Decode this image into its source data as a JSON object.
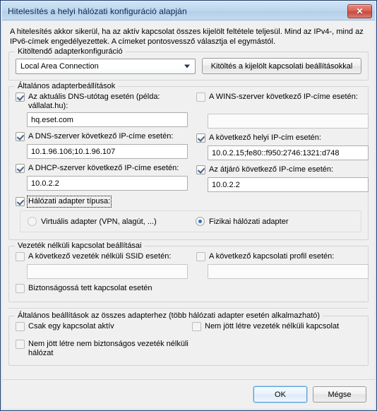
{
  "window": {
    "title": "Hitelesítés a helyi hálózati konfiguráció alapján",
    "close_label": "✕",
    "description": "A hitelesítés akkor sikerül, ha az aktív kapcsolat összes kijelölt feltétele teljesül. Mind az IPv4-, mind az IPv6-címek engedélyezettek. A címeket pontosvessző választja el egymástól."
  },
  "adapter_config": {
    "group_title": "Kitöltendő adapterkonfiguráció",
    "combo_value": "Local Area Connection",
    "fill_button_label": "Kitöltés a kijelölt kapcsolati beállításokkal"
  },
  "general_adapter": {
    "group_title": "Általános adapterbeállítások",
    "dns_suffix": {
      "label": "Az aktuális DNS-utótag esetén (példa: vállalat.hu):",
      "checked": true,
      "value": "hq.eset.com"
    },
    "wins_server": {
      "label": "A WINS-szerver következő IP-címe esetén:",
      "checked": false,
      "value": ""
    },
    "dns_server": {
      "label": "A DNS-szerver következő IP-címe esetén:",
      "checked": true,
      "value": "10.1.96.106;10.1.96.107"
    },
    "local_ip": {
      "label": "A következő helyi IP-cím esetén:",
      "checked": true,
      "value": "10.0.2.15;fe80::f950:2746:1321:d748"
    },
    "dhcp_server": {
      "label": "A DHCP-szerver következő IP-címe esetén:",
      "checked": true,
      "value": "10.0.2.2"
    },
    "gateway": {
      "label": "Az átjáró következő IP-címe esetén:",
      "checked": true,
      "value": "10.0.2.2"
    },
    "adapter_type": {
      "label": "Hálózati adapter típusa:",
      "checked": true,
      "focused": true
    },
    "radio_virtual": {
      "label": "Virtuális adapter (VPN, alagút, ...)",
      "selected": false
    },
    "radio_physical": {
      "label": "Fizikai hálózati adapter",
      "selected": true
    }
  },
  "wireless": {
    "group_title": "Vezeték nélküli kapcsolat beállításai",
    "ssid": {
      "label": "A következő vezeték nélküli SSID esetén:",
      "checked": false,
      "value": ""
    },
    "profile": {
      "label": "A következő kapcsolati profil esetén:",
      "checked": false,
      "value": ""
    },
    "secured": {
      "label": "Biztonságossá tett kapcsolat esetén",
      "checked": false
    }
  },
  "general_all": {
    "group_title": "Általános beállítások az összes adapterhez (több hálózati adapter esetén alkalmazható)",
    "only_one_active": {
      "label": "Csak egy kapcsolat aktív",
      "checked": false
    },
    "no_wireless": {
      "label": "Nem jött létre vezeték nélküli kapcsolat",
      "checked": false
    },
    "no_unsecured_wireless": {
      "label": "Nem jött létre nem biztonságos vezeték nélküli hálózat",
      "checked": false
    }
  },
  "footer": {
    "ok_label": "OK",
    "cancel_label": "Mégse"
  },
  "colors": {
    "titlebar": "#bed7ee",
    "close_button": "#c44a40",
    "checkmark": "#44638c",
    "radio_dot": "#2a72c4",
    "window_border": "#1c3e6e",
    "dialog_background": "#f0f0f0"
  }
}
